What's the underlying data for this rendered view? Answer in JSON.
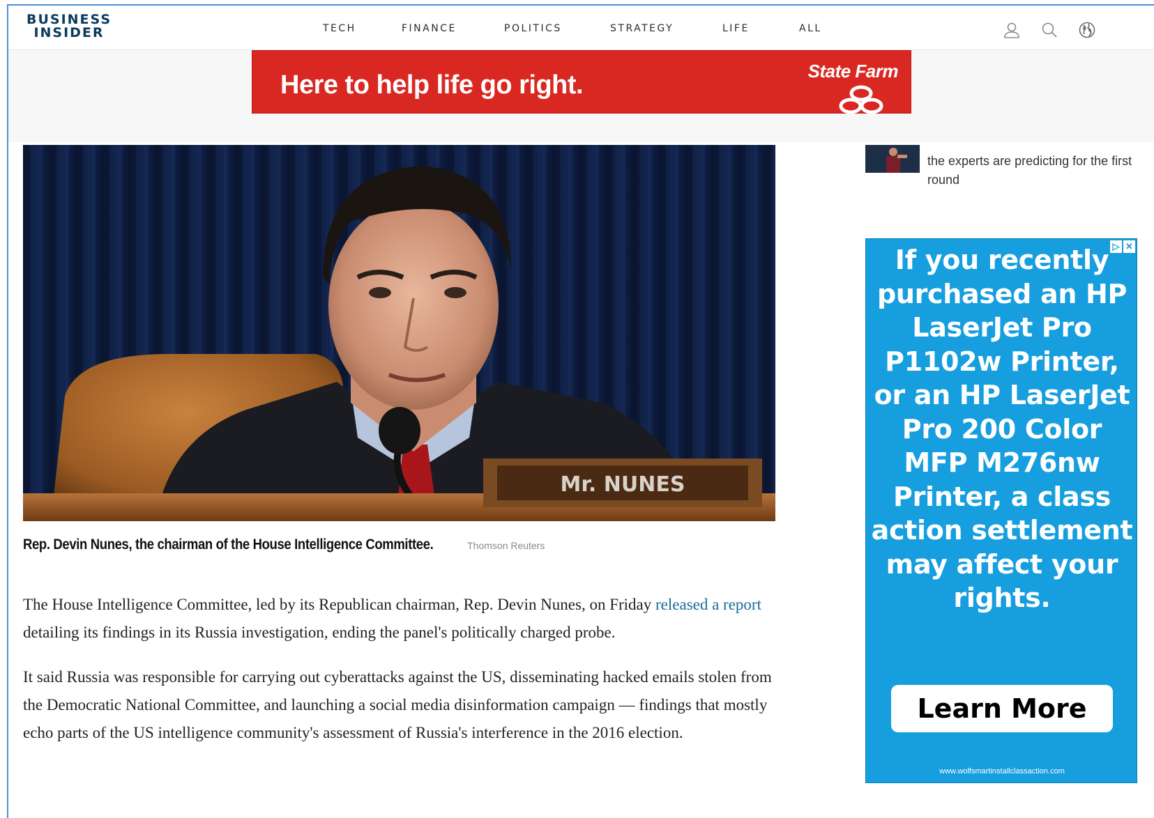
{
  "header": {
    "logo_line1": "BUSINESS",
    "logo_line2": "INSIDER",
    "nav": [
      "TECH",
      "FINANCE",
      "POLITICS",
      "STRATEGY",
      "LIFE",
      "ALL"
    ],
    "icons": [
      "user-icon",
      "search-icon",
      "globe-icon"
    ]
  },
  "top_ad": {
    "slogan": "Here to help life go right.",
    "brand": "State Farm",
    "colors": {
      "background": "#d92721",
      "text": "#ffffff"
    }
  },
  "hero": {
    "caption": "Rep. Devin Nunes, the chairman of the House Intelligence Committee.",
    "credit": "Thomson Reuters",
    "nameplate": "Mr. NUNES"
  },
  "article": {
    "p1_before_link": "The House Intelligence Committee, led by its Republican chairman, Rep. Devin Nunes, on Friday ",
    "p1_link": "released a report",
    "p1_after_link": " detailing its findings in its Russia investigation, ending the panel's politically charged probe.",
    "p2": "It said Russia was responsible for carrying out cyberattacks against the US, disseminating hacked emails stolen from the Democratic National Committee, and launching a social media disinformation campaign — findings that mostly echo parts of the US intelligence community's assessment of Russia's interference in the 2016 election.",
    "link_color": "#1a6b9a"
  },
  "sidebar": {
    "related_text": "the experts are predicting for the first round"
  },
  "side_ad": {
    "headline": "If you recently purchased an HP LaserJet Pro P1102w Printer, or an HP LaserJet Pro 200 Color MFP M276nw Printer, a class action settlement may affect your rights.",
    "button": "Learn More",
    "url": "www.wolfsmartinstallclassaction.com",
    "colors": {
      "background": "#169ede"
    }
  }
}
